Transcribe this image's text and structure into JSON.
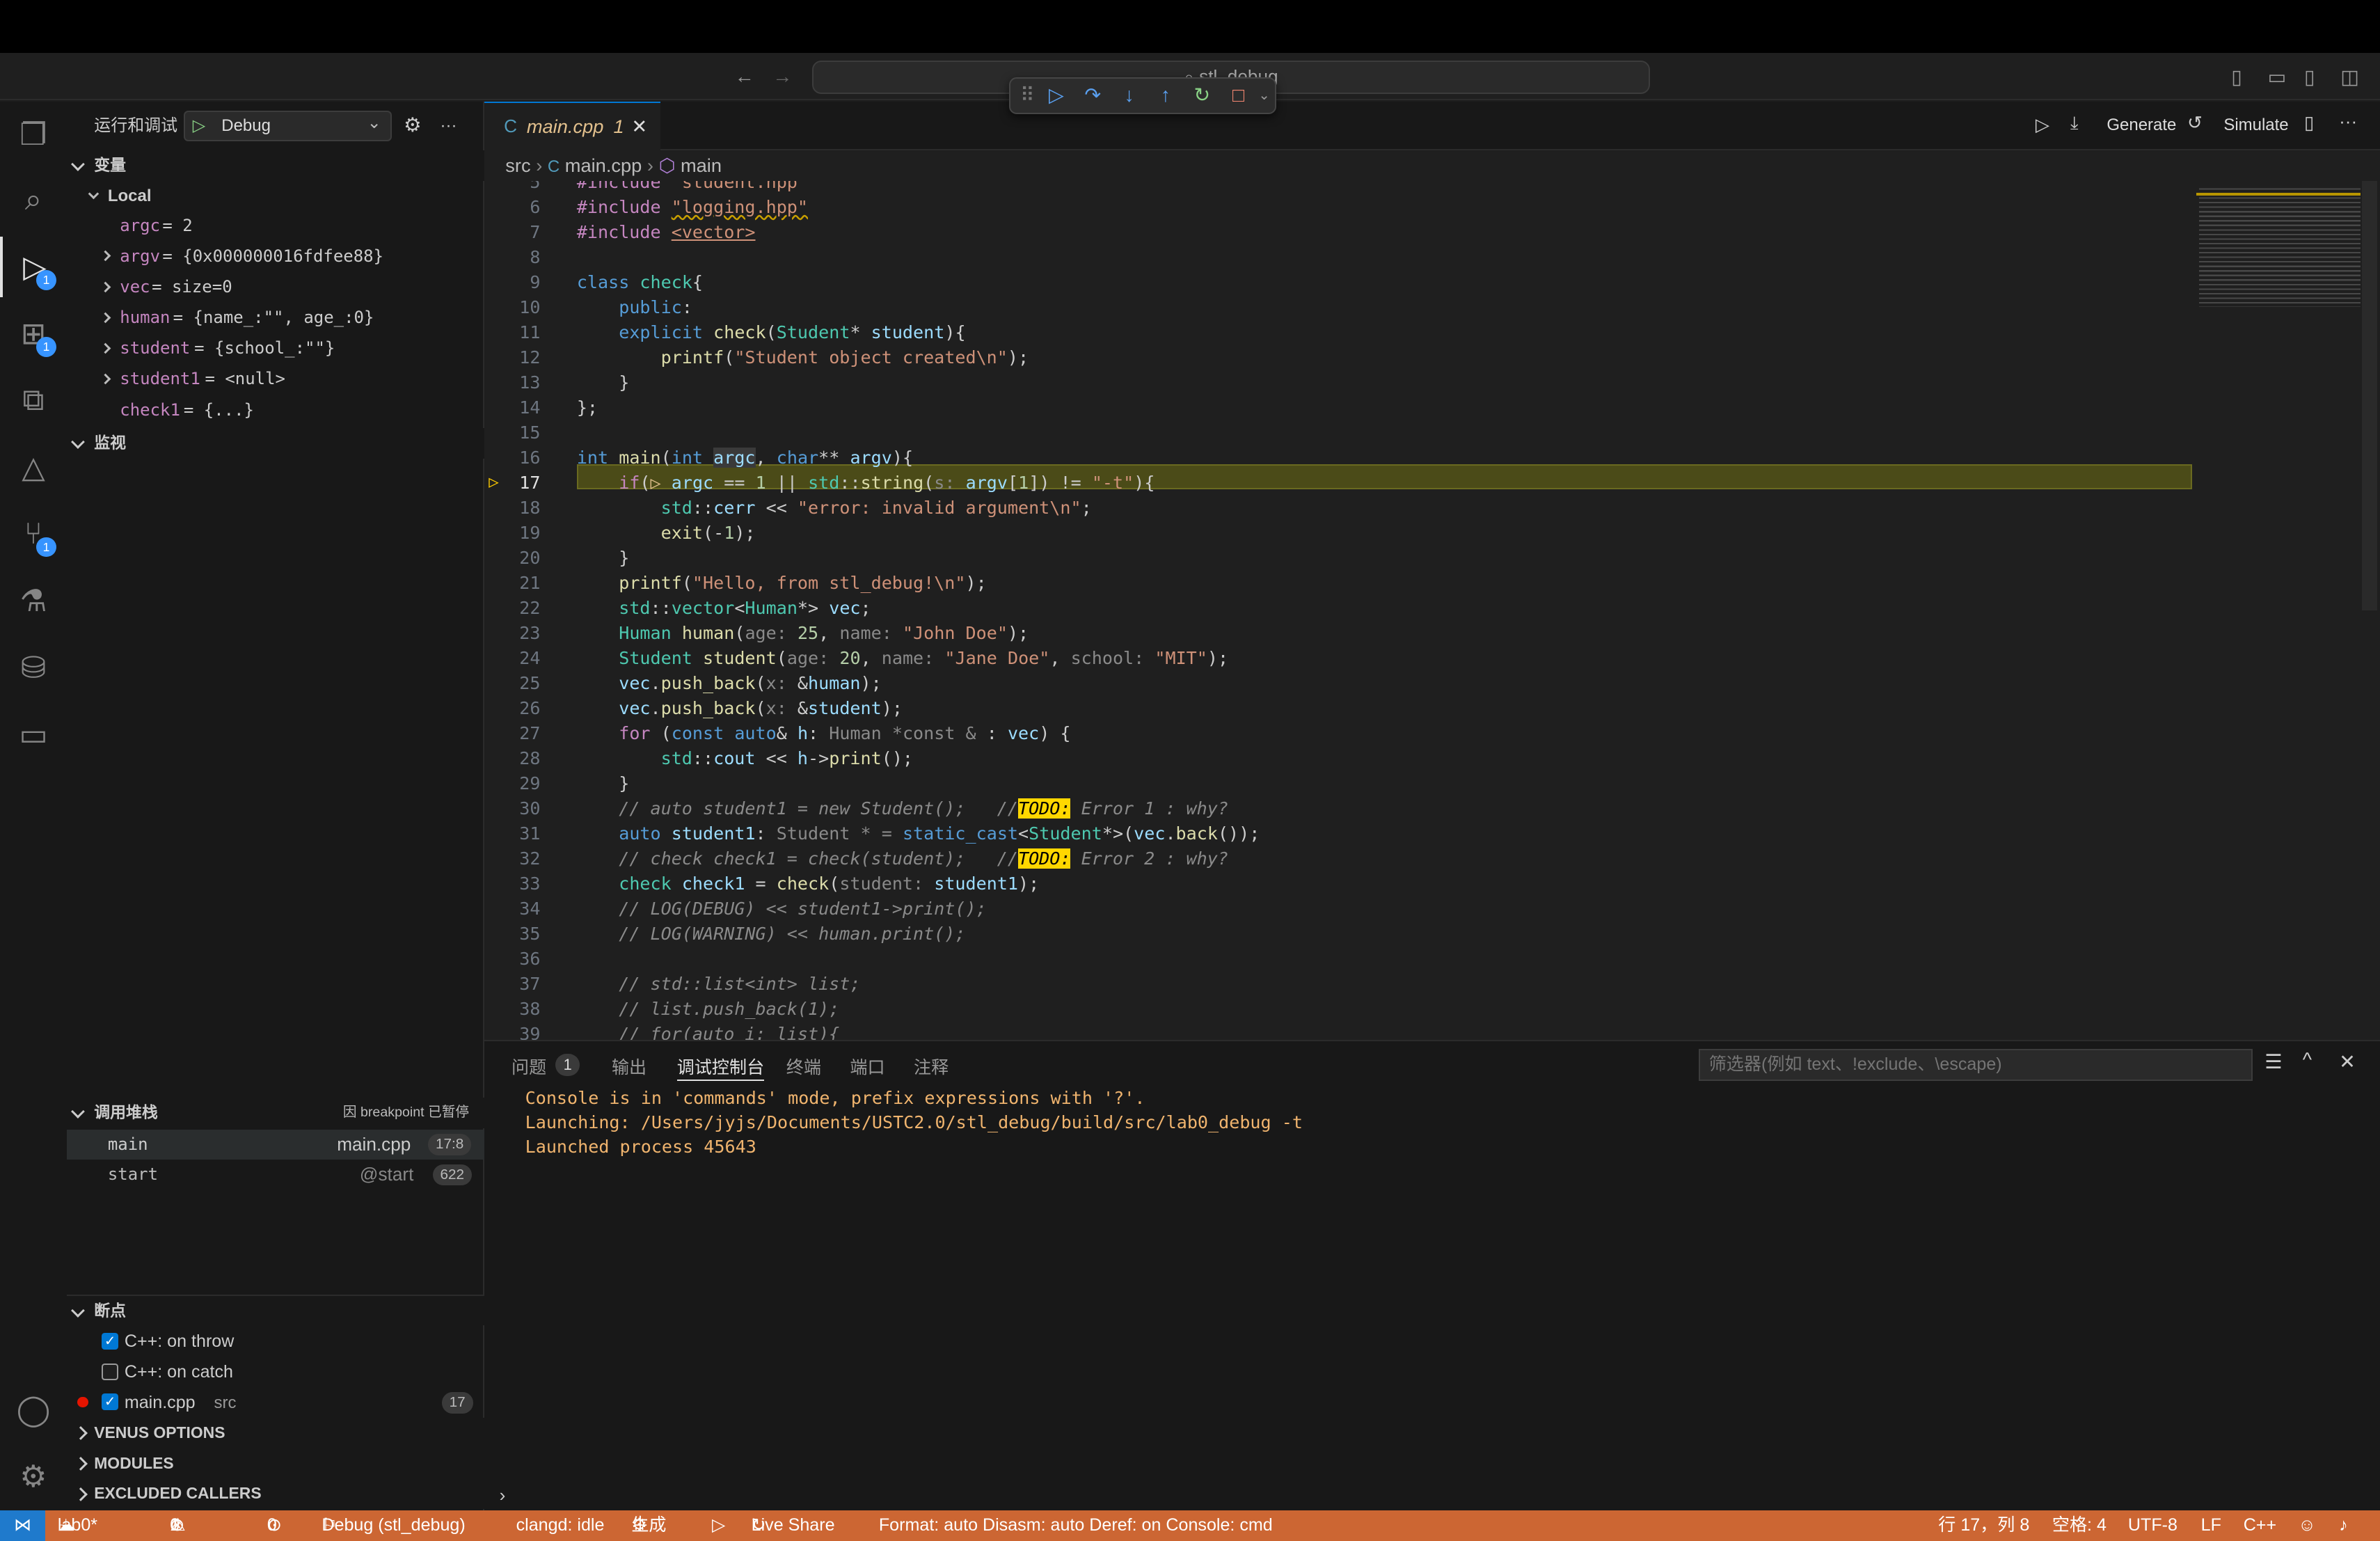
{
  "window": {
    "title": "stl_debug"
  },
  "debug_toolbar": {
    "icons": [
      "grip-icon",
      "continue-icon",
      "step-over-icon",
      "step-into-icon",
      "step-out-icon",
      "restart-icon",
      "stop-icon"
    ]
  },
  "sidebar": {
    "title": "运行和调试",
    "config": "Debug",
    "variables_header": "变量",
    "local_header": "Local",
    "variables": [
      {
        "name": "argc",
        "value": " = 2",
        "expandable": false
      },
      {
        "name": "argv",
        "value": " = {0x000000016fdfee88}",
        "expandable": true
      },
      {
        "name": "vec",
        "value": " = size=0",
        "expandable": true
      },
      {
        "name": "human",
        "value": " = {name_:\"\", age_:0}",
        "expandable": true
      },
      {
        "name": "student",
        "value": " = {school_:\"\"}",
        "expandable": true
      },
      {
        "name": "student1",
        "value": " = <null>",
        "expandable": true
      },
      {
        "name": "check1",
        "value": " = {...}",
        "expandable": false
      }
    ],
    "watch_header": "监视",
    "callstack_header": "调用堆栈",
    "callstack_status": "因 breakpoint 已暂停",
    "callstack": [
      {
        "name": "main",
        "file": "main.cpp",
        "pos": "17:8"
      },
      {
        "name": "start",
        "file": "@start",
        "pos": "622"
      }
    ],
    "breakpoints_header": "断点",
    "breakpoints": [
      {
        "label": "C++: on throw",
        "checked": true
      },
      {
        "label": "C++: on catch",
        "checked": false
      }
    ],
    "bp_file": {
      "label": "main.cpp",
      "dir": "src",
      "line": "17"
    },
    "sections": [
      "VENUS OPTIONS",
      "MODULES",
      "EXCLUDED CALLERS"
    ]
  },
  "editor": {
    "tab_label": "main.cpp",
    "tab_badge": "1",
    "breadcrumb": [
      "src",
      "main.cpp",
      "main"
    ],
    "actions": {
      "generate": "Generate",
      "simulate": "Simulate"
    },
    "current_line": "17"
  },
  "panel": {
    "tabs": [
      "问题",
      "输出",
      "调试控制台",
      "终端",
      "端口",
      "注释"
    ],
    "problems_count": "1",
    "filter_placeholder": "筛选器(例如 text、!exclude、\\escape)",
    "console": [
      "Console is in 'commands' mode, prefix expressions with '?'.",
      "Launching: /Users/jyjs/Documents/USTC2.0/stl_debug/build/src/lab0_debug -t",
      "Launched process 45643"
    ]
  },
  "status": {
    "branch": "lab0*",
    "errors": "0",
    "warnings": "1",
    "ports": "0",
    "debug": "Debug (stl_debug)",
    "clangd": "clangd: idle",
    "build": "生成",
    "liveshare": "Live Share",
    "format": "Format: auto  Disasm: auto  Deref: on  Console: cmd",
    "position": "行 17，列 8",
    "spaces": "空格: 4",
    "encoding": "UTF-8",
    "eol": "LF",
    "lang": "C++"
  },
  "colors": {
    "accent": "#0078d4",
    "statusbar": "#cc6633",
    "debugline": "#4b4b18",
    "breakpoint": "#e51400",
    "todo": "#ffd700"
  }
}
